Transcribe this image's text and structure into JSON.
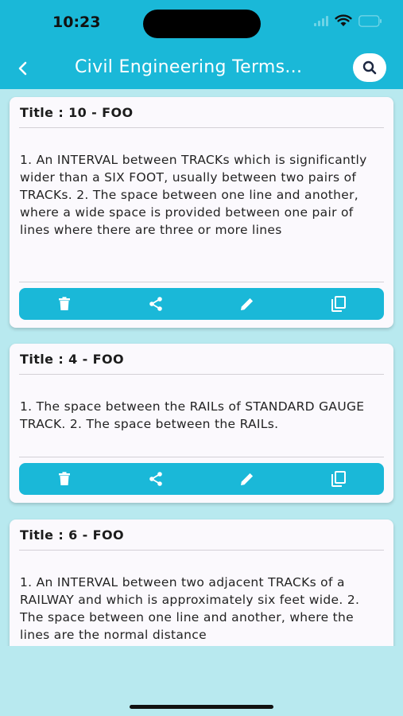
{
  "status_bar": {
    "time": "10:23"
  },
  "header": {
    "title": "Civil Engineering Terms..."
  },
  "colors": {
    "accent": "#1ab8d8",
    "background": "#b8e9ef",
    "card": "#fbf9fd"
  },
  "icons": {
    "back": "chevron-left-icon",
    "search": "search-icon",
    "delete": "trash-icon",
    "share": "share-icon",
    "edit": "pencil-icon",
    "copy": "copy-icon"
  },
  "cards": [
    {
      "title": "Title : 10 - FOO",
      "body": "1. An INTERVAL between TRACKs which is significantly wider than a SIX FOOT, usually between two pairs of TRACKs. 2. The space between one line and another, where a wide space is provided between one pair of lines where there are three or more lines"
    },
    {
      "title": "Title : 4 - FOO",
      "body": "1. The space between the RAILs of STANDARD GAUGE TRACK. 2. The space between the RAILs."
    },
    {
      "title": "Title : 6 - FOO",
      "body": "1. An INTERVAL between two adjacent TRACKs of a RAILWAY and which is approximately six feet wide. 2. The space between one line and another, where the lines are the normal distance"
    }
  ]
}
